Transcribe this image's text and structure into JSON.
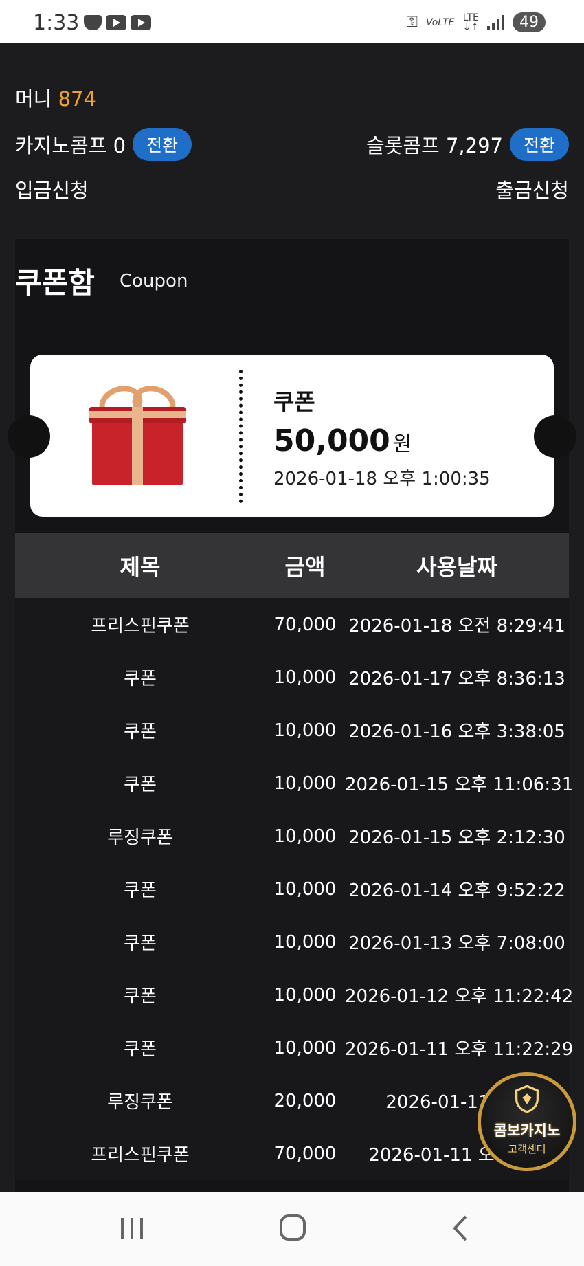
{
  "status_bar": {
    "time": "1:33",
    "volte": "VoLTE",
    "lte": "LTE",
    "battery": "49"
  },
  "account": {
    "money_label": "머니",
    "money_value": "874",
    "casino_comp_label": "카지노콤프 0",
    "slot_comp_label": "슬롯콤프 7,297",
    "convert_label": "전환",
    "deposit_label": "입금신청",
    "withdraw_label": "출금신청"
  },
  "coupon_box": {
    "title": "쿠폰함",
    "subtitle": "Coupon",
    "card": {
      "name": "쿠폰",
      "amount": "50,000",
      "unit": "원",
      "date": "2026-01-18 오후 1:00:35"
    }
  },
  "table": {
    "headers": [
      "제목",
      "금액",
      "사용날짜"
    ],
    "rows": [
      {
        "title": "프리스핀쿠폰",
        "amount": "70,000",
        "date": "2026-01-18 오전 8:29:41"
      },
      {
        "title": "쿠폰",
        "amount": "10,000",
        "date": "2026-01-17 오후 8:36:13"
      },
      {
        "title": "쿠폰",
        "amount": "10,000",
        "date": "2026-01-16 오후 3:38:05"
      },
      {
        "title": "쿠폰",
        "amount": "10,000",
        "date": "2026-01-15 오후 11:06:31"
      },
      {
        "title": "루징쿠폰",
        "amount": "10,000",
        "date": "2026-01-15 오후 2:12:30"
      },
      {
        "title": "쿠폰",
        "amount": "10,000",
        "date": "2026-01-14 오후 9:52:22"
      },
      {
        "title": "쿠폰",
        "amount": "10,000",
        "date": "2026-01-13 오후 7:08:00"
      },
      {
        "title": "쿠폰",
        "amount": "10,000",
        "date": "2026-01-12 오후 11:22:42"
      },
      {
        "title": "쿠폰",
        "amount": "10,000",
        "date": "2026-01-11 오후 11:22:29"
      },
      {
        "title": "루징쿠폰",
        "amount": "20,000",
        "date": "2026-01-11 오후"
      },
      {
        "title": "프리스핀쿠폰",
        "amount": "70,000",
        "date": "2026-01-11 오전 10:"
      }
    ]
  },
  "support_badge": {
    "name": "콤보카지노",
    "sub": "고객센터"
  },
  "icons": {
    "gift": "gift-box-icon",
    "support": "shield-icon",
    "nav_recent": "recent-apps-icon",
    "nav_home": "home-icon",
    "nav_back": "back-icon"
  },
  "colors": {
    "background": "#1c1c1e",
    "money_accent": "#f0a52a",
    "convert_button": "#1f6fc9",
    "table_header": "#343436"
  }
}
